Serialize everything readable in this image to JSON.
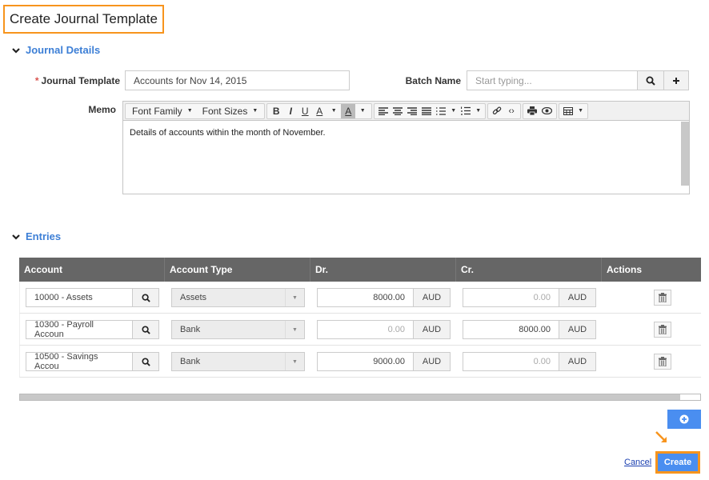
{
  "page": {
    "title": "Create Journal Template"
  },
  "sections": {
    "journal_details": "Journal Details",
    "entries": "Entries"
  },
  "form": {
    "journal_template": {
      "label": "Journal Template",
      "required_mark": "*",
      "value": "Accounts for Nov 14, 2015"
    },
    "batch_name": {
      "label": "Batch Name",
      "placeholder": "Start typing...",
      "value": ""
    },
    "memo": {
      "label": "Memo",
      "value": "Details of accounts within the month of November.",
      "toolbar": {
        "font_family": "Font Family",
        "font_sizes": "Font Sizes",
        "bold": "B",
        "italic": "I",
        "underline": "U",
        "text_color": "A",
        "bg_color": "A"
      }
    }
  },
  "entries": {
    "columns": [
      "Account",
      "Account Type",
      "Dr.",
      "Cr.",
      "Actions"
    ],
    "currency": "AUD",
    "rows": [
      {
        "account": "10000 - Assets",
        "type": "Assets",
        "dr": "8000.00",
        "cr": "0.00"
      },
      {
        "account": "10300 - Payroll Accoun",
        "type": "Bank",
        "dr": "0.00",
        "cr": "8000.00"
      },
      {
        "account": "10500 - Savings Accou",
        "type": "Bank",
        "dr": "9000.00",
        "cr": "0.00"
      }
    ]
  },
  "actions": {
    "cancel": "Cancel",
    "create": "Create"
  },
  "colors": {
    "accent": "#4a8ef0",
    "highlight": "#f7941d",
    "section": "#3d7fd6",
    "grid_header": "#666666"
  }
}
